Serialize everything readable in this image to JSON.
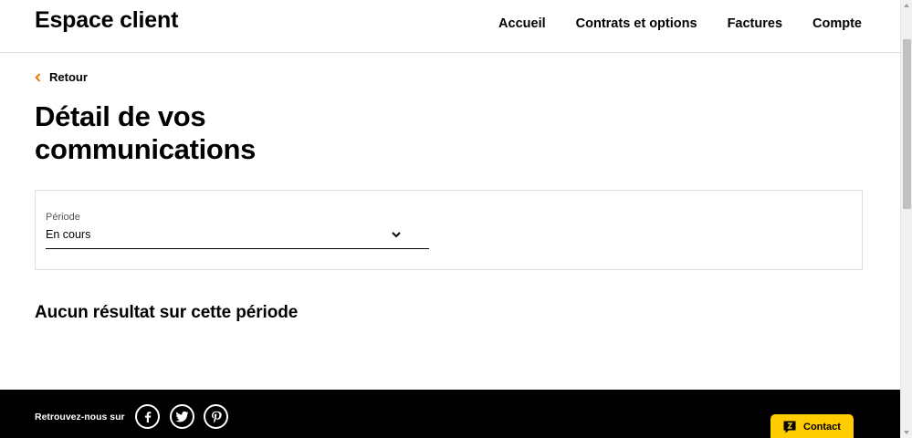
{
  "header": {
    "brand": "Espace client",
    "nav": [
      {
        "label": "Accueil"
      },
      {
        "label": "Contrats et options"
      },
      {
        "label": "Factures"
      },
      {
        "label": "Compte"
      }
    ]
  },
  "back": {
    "label": "Retour",
    "icon": "chevron-left-icon",
    "color": "#f16e00"
  },
  "page_title": "Détail de vos communications",
  "period": {
    "label": "Période",
    "selected": "En cours",
    "icon": "chevron-down-icon"
  },
  "empty_message": "Aucun résultat sur cette période",
  "footer": {
    "follow_label": "Retrouvez-nous sur",
    "social": [
      {
        "name": "facebook-icon"
      },
      {
        "name": "twitter-icon"
      },
      {
        "name": "pinterest-icon"
      }
    ],
    "contact_label": "Contact",
    "contact_color": "#ffcc00"
  }
}
